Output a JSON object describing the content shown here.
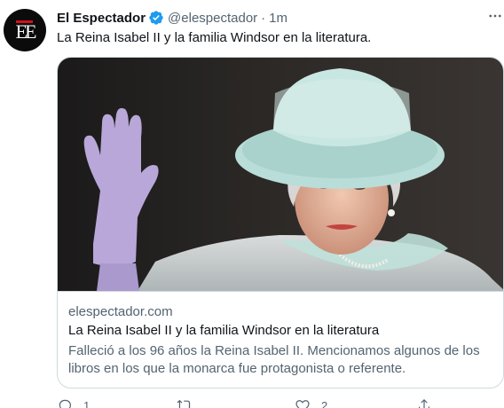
{
  "tweet": {
    "author_name": "El Espectador",
    "author_handle": "@elespectador",
    "separator": "·",
    "time": "1m",
    "text": "La Reina Isabel II y la familia Windsor en la literatura.",
    "avatar_text": "EE"
  },
  "card": {
    "domain": "elespectador.com",
    "title": "La Reina Isabel II y la familia Windsor en la literatura",
    "description": "Falleció a los 96 años la Reina Isabel II. Mencionamos algunos de los libros en los que la monarca fue protagonista o referente."
  },
  "actions": {
    "reply_count": "1",
    "like_count": "2"
  },
  "icons": {
    "verified": "verified-badge-icon",
    "more": "more-options-icon",
    "reply": "reply-icon",
    "retweet": "retweet-icon",
    "like": "like-icon",
    "share": "share-icon"
  },
  "colors": {
    "verified": "#1d9bf0",
    "secondary_text": "#536471",
    "primary_text": "#0f1419",
    "border": "#cfd9de",
    "brand_red": "#d0121b"
  }
}
